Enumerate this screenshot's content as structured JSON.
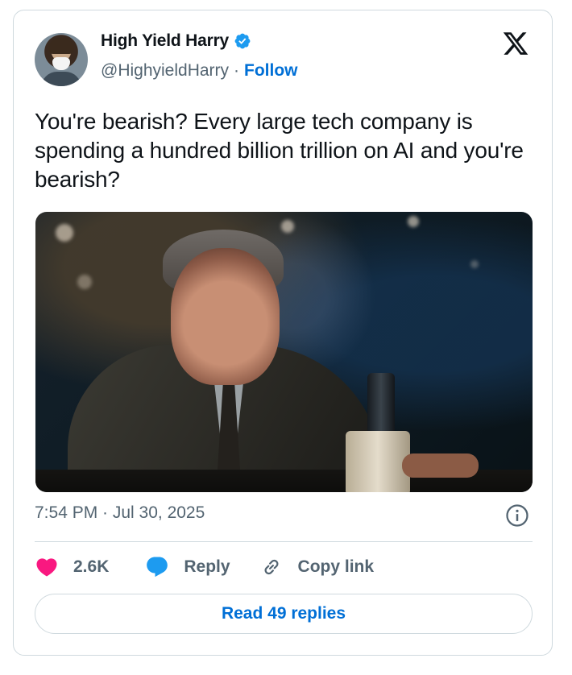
{
  "author": {
    "display_name": "High Yield Harry",
    "handle": "@HighyieldHarry",
    "separator": "·",
    "follow_label": "Follow"
  },
  "tweet": {
    "text": "You're bearish? Every large tech company is spending a hundred billion trillion on AI and you're bearish?",
    "timestamp": "7:54 PM · Jul 30, 2025"
  },
  "actions": {
    "likes": "2.6K",
    "reply_label": "Reply",
    "copy_link_label": "Copy link"
  },
  "read_replies_label": "Read 49 replies",
  "icons": {
    "verified": "verified-badge-icon",
    "platform": "x-logo-icon",
    "info": "info-icon",
    "like": "heart-icon",
    "reply": "speech-bubble-icon",
    "link": "link-icon"
  },
  "colors": {
    "accent": "#006fd6",
    "like": "#f91880",
    "muted": "#536471",
    "border": "#cfd9de"
  }
}
